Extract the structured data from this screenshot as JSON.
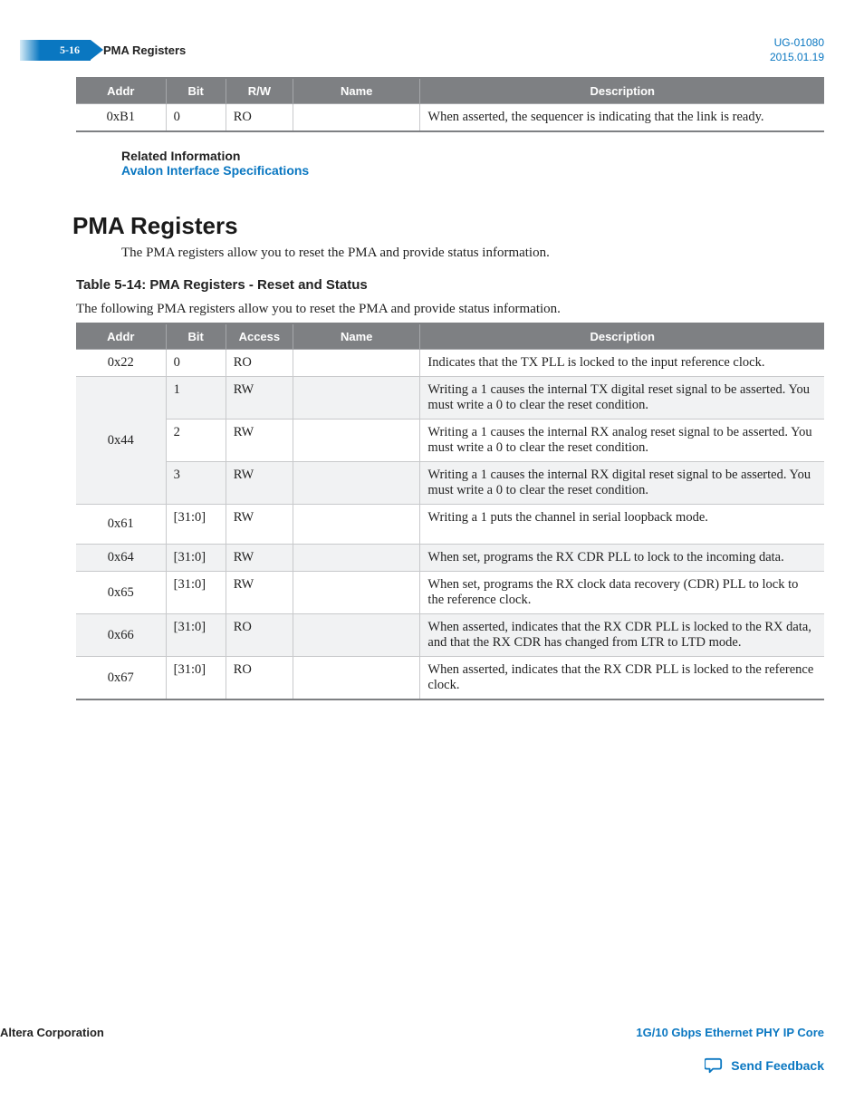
{
  "header": {
    "page_label": "5-16",
    "breadcrumb": "PMA Registers",
    "doc_id": "UG-01080",
    "doc_date": "2015.01.19"
  },
  "top_table": {
    "headers": {
      "addr": "Addr",
      "bit": "Bit",
      "rw": "R/W",
      "name": "Name",
      "desc": "Description"
    },
    "rows": [
      {
        "addr": "0xB1",
        "bit": "0",
        "rw": "RO",
        "name": "",
        "desc": "When asserted, the sequencer is indicating that the link is ready."
      }
    ]
  },
  "related": {
    "title": "Related Information",
    "link_text": "Avalon Interface Specifications"
  },
  "section": {
    "title": "PMA Registers",
    "intro": "The PMA registers allow you to reset the PMA and provide status information.",
    "table_caption": "Table 5-14: PMA Registers - Reset and Status",
    "table_lead": "The following PMA registers allow you to reset the PMA and provide status information."
  },
  "main_table": {
    "headers": {
      "addr": "Addr",
      "bit": "Bit",
      "access": "Access",
      "name": "Name",
      "desc": "Description"
    },
    "rows": [
      {
        "addr": "0x22",
        "bit": "0",
        "access": "RO",
        "name": "",
        "desc": "Indicates that the TX PLL is locked to the input reference clock."
      },
      {
        "addr": "0x44",
        "bit": "1",
        "access": "RW",
        "name": "",
        "desc": "Writing a 1 causes the internal TX digital reset signal to be asserted. You must write a 0 to clear the reset condition."
      },
      {
        "addr": "",
        "bit": "2",
        "access": "RW",
        "name": "",
        "desc": "Writing a 1 causes the internal RX analog reset signal to be asserted. You must write a 0 to clear the reset condition."
      },
      {
        "addr": "",
        "bit": "3",
        "access": "RW",
        "name": "",
        "desc": "Writing a 1 causes the internal RX digital reset signal to be asserted. You must write a 0 to clear the reset condition."
      },
      {
        "addr": "0x61",
        "bit": "[31:0]",
        "access": "RW",
        "name": "",
        "desc": "Writing a 1 puts the channel in serial loopback mode."
      },
      {
        "addr": "0x64",
        "bit": "[31:0]",
        "access": "RW",
        "name": "",
        "desc": "When set, programs the RX CDR PLL to lock to the incoming data."
      },
      {
        "addr": "0x65",
        "bit": "[31:0]",
        "access": "RW",
        "name": "",
        "desc": "When set, programs the RX clock data recovery (CDR) PLL to lock to the reference clock."
      },
      {
        "addr": "0x66",
        "bit": "[31:0]",
        "access": "RO",
        "name": "",
        "desc": "When asserted, indicates that the RX CDR PLL is locked to the RX data, and that the RX CDR has changed from LTR to LTD mode."
      },
      {
        "addr": "0x67",
        "bit": "[31:0]",
        "access": "RO",
        "name": "",
        "desc": "When asserted, indicates that the RX CDR PLL is locked to the reference clock."
      }
    ]
  },
  "footer": {
    "company": "Altera Corporation",
    "product": "1G/10 Gbps Ethernet PHY IP Core",
    "feedback": "Send Feedback"
  }
}
